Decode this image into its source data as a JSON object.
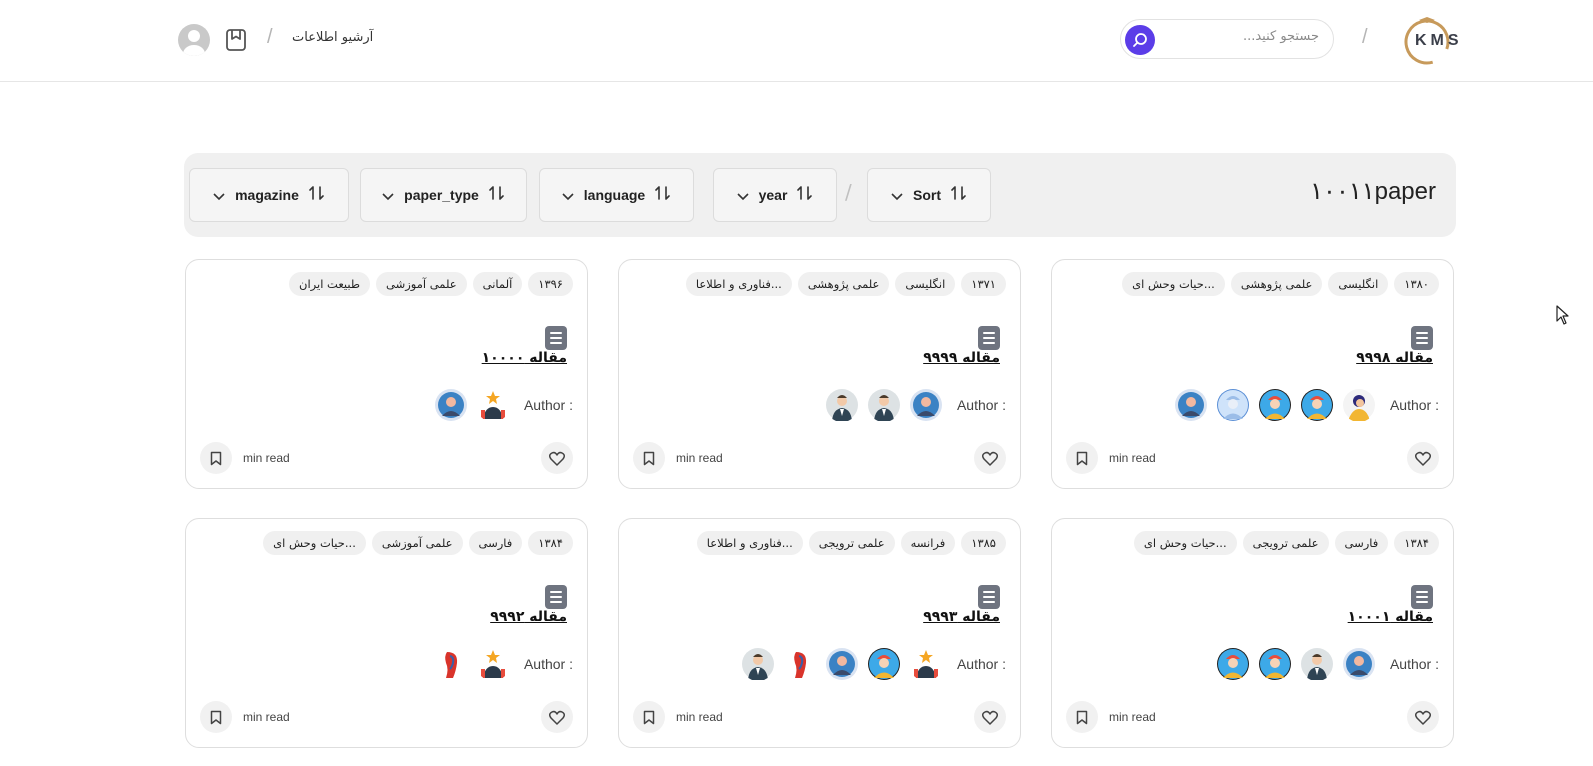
{
  "header": {
    "logo_text": "KMS",
    "search_placeholder": "جستجو کنید...",
    "archive_link": "آرشیو اطلاعات"
  },
  "filters": {
    "count_title": "۱۰۰۱۱paper",
    "buttons": [
      {
        "label": "Sort"
      },
      {
        "label": "year"
      },
      {
        "label": "language"
      },
      {
        "label": "paper_type"
      },
      {
        "label": "magazine"
      }
    ]
  },
  "cards": [
    {
      "tags": [
        "۱۳۸۰",
        "انگلیسی",
        "علمی پژوهشی",
        "حیات وحش ای..."
      ],
      "title": "مقاله ۹۹۹۸",
      "author_label": "Author :",
      "read_label": "min read",
      "avatars": [
        "cartoon-woman",
        "worker-blue",
        "worker-blue",
        "worker-light",
        "person-blue"
      ]
    },
    {
      "tags": [
        "۱۳۷۱",
        "انگلیسی",
        "علمی پژوهشی",
        "فناوری و اطلاعا..."
      ],
      "title": "مقاله ۹۹۹۹",
      "author_label": "Author :",
      "read_label": "min read",
      "avatars": [
        "person-blue",
        "businessman",
        "businessman"
      ]
    },
    {
      "tags": [
        "۱۳۹۶",
        "آلمانی",
        "علمی آموزشی",
        "طبیعت ایران"
      ],
      "title": "مقاله ۱۰۰۰۰",
      "author_label": "Author :",
      "read_label": "min read",
      "avatars": [
        "star-figure",
        "person-blue"
      ]
    },
    {
      "tags": [
        "۱۳۸۴",
        "فارسی",
        "علمی ترویجی",
        "حیات وحش ای..."
      ],
      "title": "مقاله ۱۰۰۰۱",
      "author_label": "Author :",
      "read_label": "min read",
      "avatars": [
        "person-blue",
        "businessman",
        "worker-blue",
        "worker-blue"
      ]
    },
    {
      "tags": [
        "۱۳۸۵",
        "فرانسه",
        "علمی ترویجی",
        "فناوری و اطلاعا..."
      ],
      "title": "مقاله ۹۹۹۳",
      "author_label": "Author :",
      "read_label": "min read",
      "avatars": [
        "star-figure",
        "worker-blue",
        "person-blue",
        "red-profile",
        "businessman"
      ]
    },
    {
      "tags": [
        "۱۳۸۴",
        "فارسی",
        "علمی آموزشی",
        "حیات وحش ای..."
      ],
      "title": "مقاله ۹۹۹۲",
      "author_label": "Author :",
      "read_label": "min read",
      "avatars": [
        "star-figure",
        "red-profile"
      ]
    }
  ]
}
